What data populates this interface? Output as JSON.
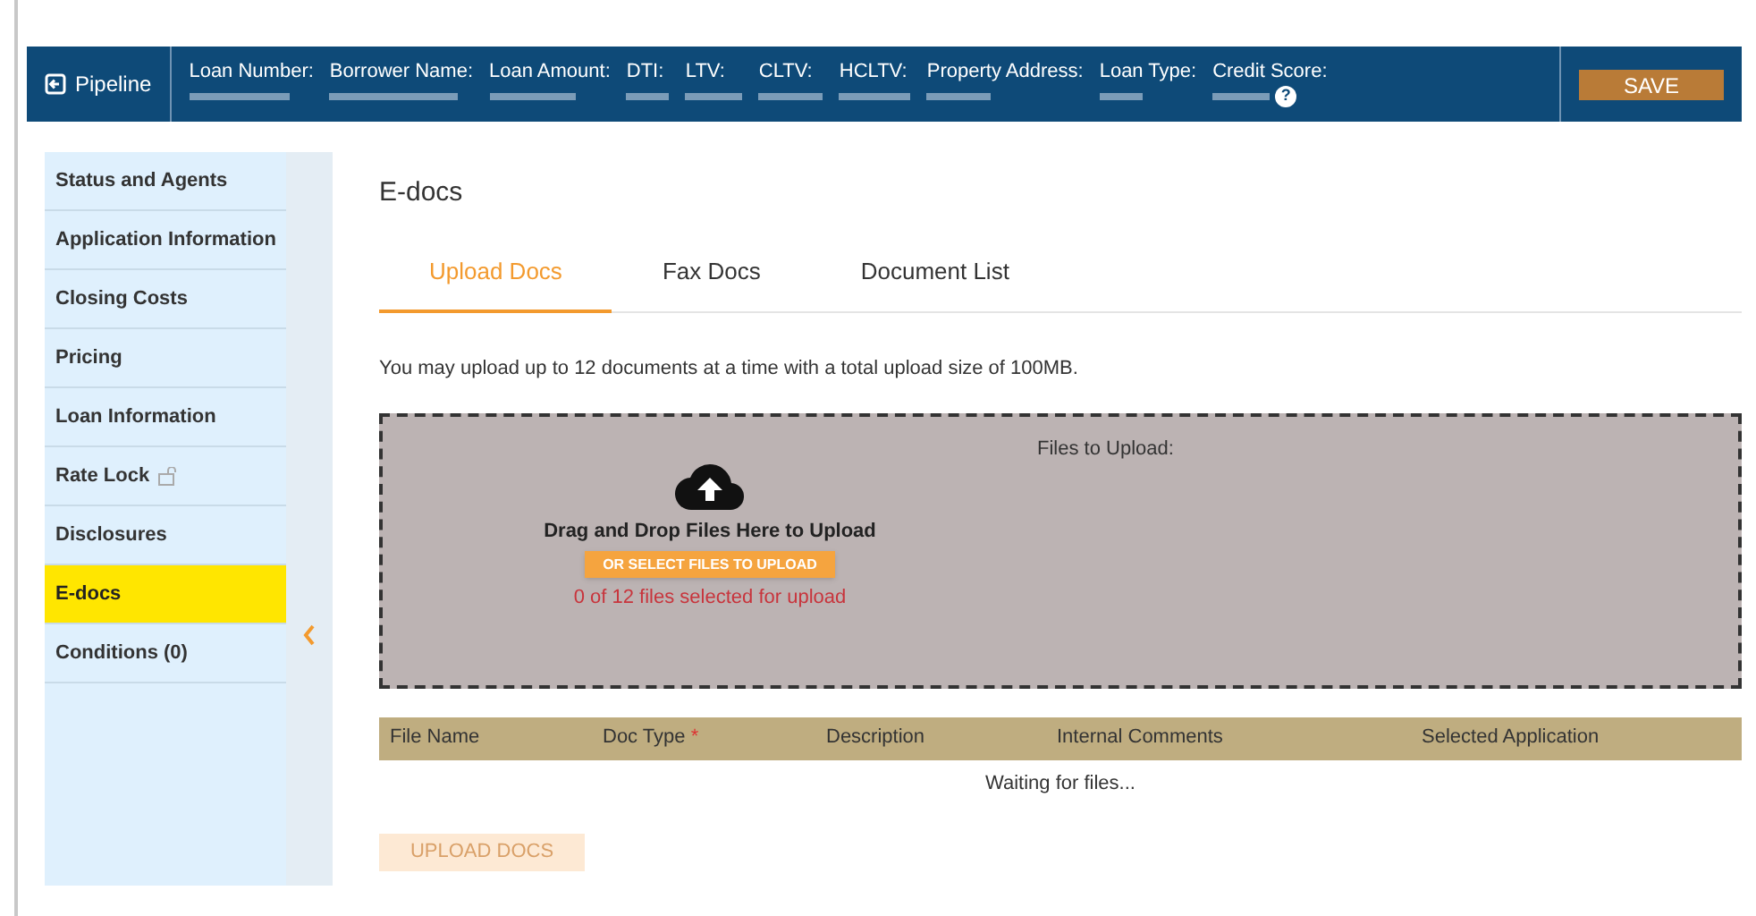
{
  "header": {
    "pipeline": "Pipeline",
    "fields": [
      {
        "label": "Loan Number:"
      },
      {
        "label": "Borrower Name:"
      },
      {
        "label": "Loan Amount:"
      },
      {
        "label": "DTI:"
      },
      {
        "label": "LTV:"
      },
      {
        "label": "CLTV:"
      },
      {
        "label": "HCLTV:"
      },
      {
        "label": "Property Address:"
      },
      {
        "label": "Loan Type:"
      },
      {
        "label": "Credit Score:",
        "help": "?"
      }
    ],
    "save": "SAVE"
  },
  "sidebar": {
    "items": [
      {
        "label": "Status and Agents",
        "selected": false
      },
      {
        "label": "Application Information",
        "selected": false
      },
      {
        "label": "Closing Costs",
        "selected": false
      },
      {
        "label": "Pricing",
        "selected": false
      },
      {
        "label": "Loan Information",
        "selected": false
      },
      {
        "label": "Rate Lock",
        "selected": false,
        "lock": true
      },
      {
        "label": "Disclosures",
        "selected": false
      },
      {
        "label": "E-docs",
        "selected": true
      },
      {
        "label": "Conditions (0)",
        "selected": false
      }
    ]
  },
  "page": {
    "title": "E-docs",
    "tabs": [
      {
        "label": "Upload Docs",
        "selected": true
      },
      {
        "label": "Fax Docs",
        "selected": false
      },
      {
        "label": "Document List",
        "selected": false
      }
    ],
    "note": "You may upload up to 12 documents at a time with a total upload size of 100MB.",
    "dropzone": {
      "files_label": "Files to Upload:",
      "drag_text": "Drag and Drop Files Here to Upload",
      "select_button": "OR SELECT FILES TO UPLOAD",
      "count": "0 of 12 files selected for upload"
    },
    "table": {
      "columns": [
        {
          "label": "File Name"
        },
        {
          "label": "Doc Type",
          "required": true,
          "required_mark": "*"
        },
        {
          "label": "Description"
        },
        {
          "label": "Internal Comments"
        },
        {
          "label": "Selected Application"
        }
      ],
      "empty": "Waiting for files..."
    },
    "upload_button": {
      "label": "UPLOAD DOCS",
      "disabled": true
    }
  }
}
